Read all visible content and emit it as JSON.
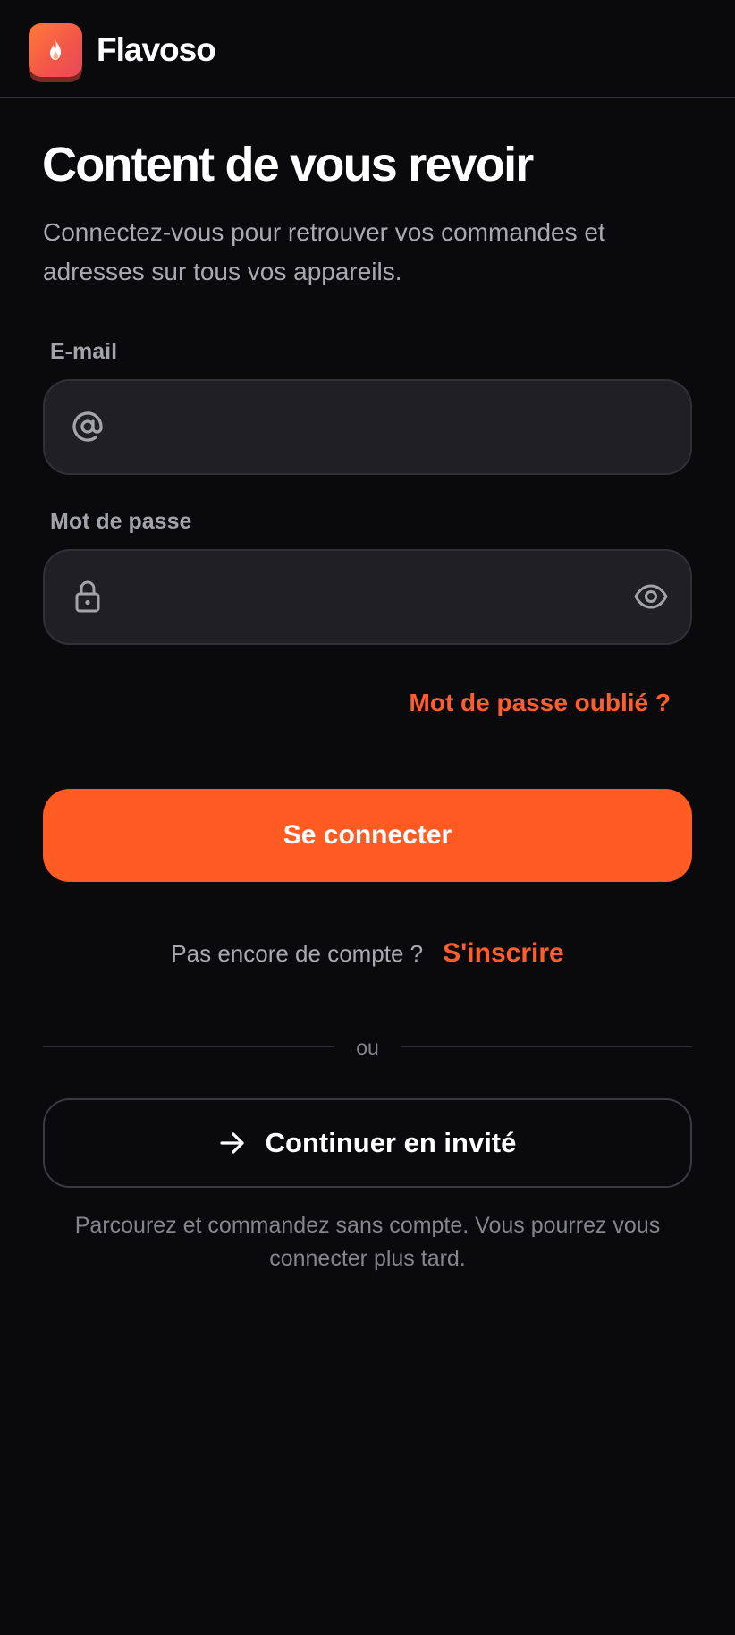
{
  "brand": {
    "name": "Flavoso",
    "logo_icon": "flame-icon",
    "accent_color": "#ff5b22"
  },
  "login": {
    "title": "Content de vous revoir",
    "subtitle": "Connectez-vous pour retrouver vos commandes et adresses sur tous vos appareils.",
    "email": {
      "label": "E-mail",
      "value": "",
      "placeholder": "",
      "icon": "at-sign-icon"
    },
    "password": {
      "label": "Mot de passe",
      "value": "",
      "placeholder": "",
      "icon": "lock-icon",
      "toggle_icon": "eye-icon"
    },
    "forgot_password": "Mot de passe oublié ?",
    "submit_label": "Se connecter",
    "signup_prompt": "Pas encore de compte ?",
    "signup_link": "S'inscrire",
    "divider_text": "ou",
    "guest_label": "Continuer en invité",
    "guest_icon": "arrow-right-icon",
    "guest_note": "Parcourez et commandez sans compte. Vous pourrez vous connecter plus tard."
  }
}
